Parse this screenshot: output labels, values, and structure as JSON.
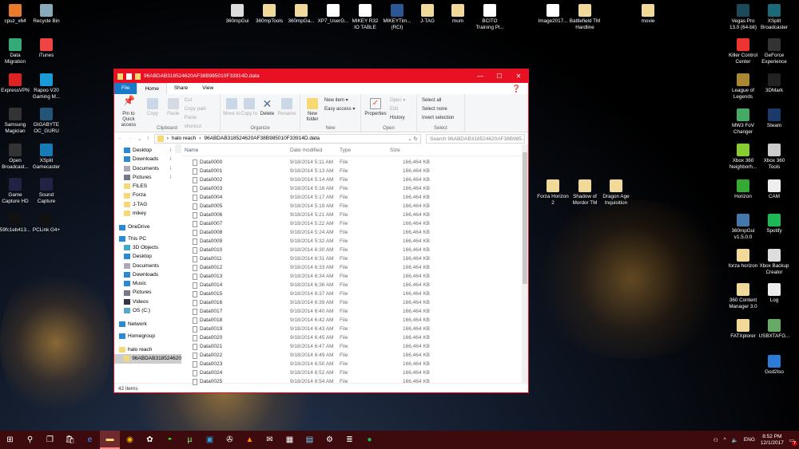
{
  "desktop": {
    "icons": [
      "cpuz_x64",
      "Recycle Bin",
      "360mpGui",
      "360mpTools",
      "360mpGa...",
      "XP7_UserG...",
      "MIKEY R32 IO TABLE",
      "MIKEYTim... (RCI)",
      "J-TAG",
      "mum",
      "BCITO Training Pl...",
      "Image2017...",
      "Battlefield TM Hardline",
      "movie",
      "Vegas Pro 13.0 (64-bit)",
      "XSplit Broadcaster",
      "Data Migration",
      "iTunes",
      "ExpressVPN",
      "Rapoo V20 Gaming M...",
      "Samsung Magician",
      "GIGABYTE OC_GURU",
      "Open Broadcast...",
      "XSplit Gamecaster",
      "Game Capture HD",
      "Sound Capture",
      "59fc1eb413...",
      "PCLink G4+",
      "Killer Control Center",
      "GeForce Experience",
      "League of Legends",
      "3DMark",
      "MW3 FoV Changer",
      "Steam",
      "Xbox 360 Neighborh...",
      "Xbox 360 Tools",
      "Horizon",
      "CAM",
      "360mpGui v1.5.0.0",
      "Spotify",
      "forza horizon",
      "Xbox Backup Creator",
      "360 Content Manager 3.0",
      "Log",
      "FATXplorer",
      "USBXTAFG...",
      "God2Iso",
      "Forza Horizon 2",
      "Shadow of Mordor TM",
      "Dragon Age Inquisition"
    ]
  },
  "explorer": {
    "title": "96ABDAB318524620AF38B985010F33914D.data",
    "accent": "#e81123",
    "tabs": [
      "File",
      "Home",
      "Share",
      "View"
    ],
    "ribbon": {
      "clipboard": {
        "label": "Clipboard",
        "pin": "Pin to Quick access",
        "copy": "Copy",
        "paste": "Paste",
        "cut": "Cut",
        "copy_path": "Copy path",
        "paste_shortcut": "Paste shortcut"
      },
      "organize": {
        "label": "Organize",
        "move": "Move to",
        "copy": "Copy to",
        "delete": "Delete",
        "rename": "Rename"
      },
      "new": {
        "label": "New",
        "folder": "New folder",
        "item": "New item ▾",
        "easy": "Easy access ▾"
      },
      "open": {
        "label": "Open",
        "properties": "Properties",
        "open": "Open ▾",
        "edit": "Edit",
        "history": "History"
      },
      "select": {
        "label": "Select",
        "all": "Select all",
        "none": "Select none",
        "invert": "Invert selection"
      }
    },
    "breadcrumb": [
      "halo reach",
      "96ABDAB318524620AF38B985010F33914D.data"
    ],
    "search_placeholder": "Search 96ABDAB318524620AF38B985...",
    "nav": [
      "Desktop",
      "Downloads",
      "Documents",
      "Pictures",
      "FILES",
      "Forza",
      "J-TAG",
      "mikey",
      "OneDrive",
      "This PC",
      "3D Objects",
      "Desktop",
      "Documents",
      "Downloads",
      "Music",
      "Pictures",
      "Videos",
      "OS (C:)",
      "Network",
      "Homegroup",
      "halo reach",
      "96ABDAB318524620"
    ],
    "columns": [
      "Name",
      "Date modified",
      "Type",
      "Size"
    ],
    "files": [
      [
        "Data0000",
        "9/18/2014 5:11 AM"
      ],
      [
        "Data0001",
        "9/18/2014 5:13 AM"
      ],
      [
        "Data0002",
        "9/18/2014 5:14 AM"
      ],
      [
        "Data0003",
        "9/18/2014 5:16 AM"
      ],
      [
        "Data0004",
        "9/18/2014 5:17 AM"
      ],
      [
        "Data0005",
        "9/18/2014 5:19 AM"
      ],
      [
        "Data0006",
        "9/18/2014 5:21 AM"
      ],
      [
        "Data0007",
        "9/18/2014 5:22 AM"
      ],
      [
        "Data0008",
        "9/18/2014 5:24 AM"
      ],
      [
        "Data0009",
        "9/18/2014 5:32 AM"
      ],
      [
        "Data0010",
        "9/18/2014 6:30 AM"
      ],
      [
        "Data0011",
        "9/18/2014 6:31 AM"
      ],
      [
        "Data0012",
        "9/18/2014 6:33 AM"
      ],
      [
        "Data0013",
        "9/18/2014 6:34 AM"
      ],
      [
        "Data0014",
        "9/18/2014 6:36 AM"
      ],
      [
        "Data0015",
        "9/18/2014 6:37 AM"
      ],
      [
        "Data0016",
        "9/18/2014 6:39 AM"
      ],
      [
        "Data0017",
        "9/18/2014 6:40 AM"
      ],
      [
        "Data0018",
        "9/18/2014 6:42 AM"
      ],
      [
        "Data0019",
        "9/18/2014 6:43 AM"
      ],
      [
        "Data0020",
        "9/18/2014 6:45 AM"
      ],
      [
        "Data0021",
        "9/18/2014 6:47 AM"
      ],
      [
        "Data0022",
        "9/18/2014 6:49 AM"
      ],
      [
        "Data0023",
        "9/18/2014 6:50 AM"
      ],
      [
        "Data0024",
        "9/18/2014 6:52 AM"
      ],
      [
        "Data0025",
        "9/18/2014 6:54 AM"
      ]
    ],
    "file_type": "File",
    "file_size": "166,464 KB",
    "status": "42 items"
  },
  "taskbar": {
    "lang": "ENG",
    "time": "8:52 PM",
    "date": "12/1/2017",
    "notifications": "7"
  }
}
